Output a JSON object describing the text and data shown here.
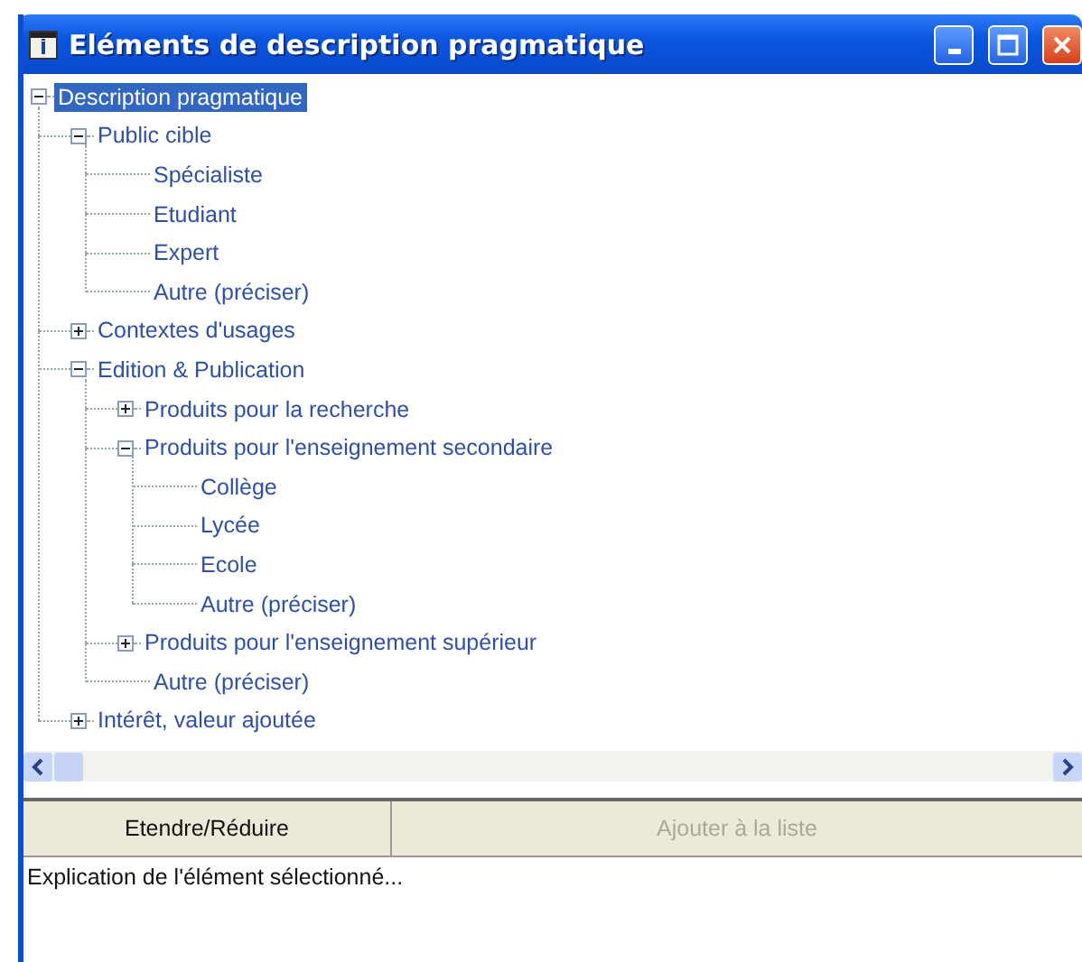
{
  "window": {
    "title": "Eléments de description pragmatique"
  },
  "tree": [
    {
      "label": "Description pragmatique",
      "selected": true,
      "expanded": true,
      "children": [
        {
          "label": "Public cible",
          "selected": false,
          "expanded": true,
          "children": [
            {
              "label": "Spécialiste",
              "selected": false
            },
            {
              "label": "Etudiant",
              "selected": false
            },
            {
              "label": "Expert",
              "selected": false
            },
            {
              "label": "Autre (préciser)",
              "selected": false
            }
          ]
        },
        {
          "label": "Contextes d'usages",
          "selected": false,
          "expanded": false
        },
        {
          "label": "Edition & Publication",
          "selected": false,
          "expanded": true,
          "children": [
            {
              "label": "Produits pour la recherche",
              "selected": false,
              "expanded": false
            },
            {
              "label": "Produits pour l'enseignement secondaire",
              "selected": false,
              "expanded": true,
              "children": [
                {
                  "label": "Collège",
                  "selected": false
                },
                {
                  "label": "Lycée",
                  "selected": false
                },
                {
                  "label": "Ecole",
                  "selected": false
                },
                {
                  "label": "Autre (préciser)",
                  "selected": false
                }
              ]
            },
            {
              "label": "Produits pour l'enseignement supérieur",
              "selected": false,
              "expanded": false
            },
            {
              "label": "Autre (préciser)",
              "selected": false
            }
          ]
        },
        {
          "label": "Intérêt, valeur ajoutée",
          "selected": false,
          "expanded": false
        }
      ]
    }
  ],
  "buttons": [
    {
      "label": "Etendre/Réduire",
      "disabled": false
    },
    {
      "label": "Ajouter à la liste",
      "disabled": true
    }
  ],
  "explanation": "Explication de l'élément sélectionné..."
}
